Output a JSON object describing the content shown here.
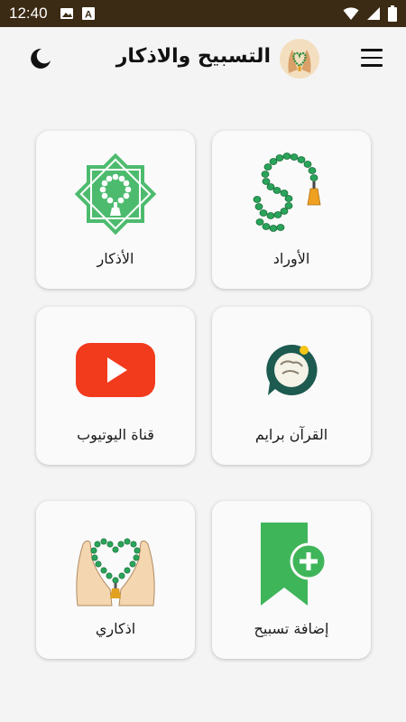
{
  "status_bar": {
    "time": "12:40",
    "left_icons": [
      "image-icon",
      "keyboard-a-icon"
    ],
    "right_icons": [
      "wifi-icon",
      "signal-icon",
      "battery-icon"
    ]
  },
  "app_bar": {
    "title": "التسبيح والاذكار",
    "menu_icon": "menu-icon",
    "theme_icon": "moon-icon",
    "logo_icon": "hands-heart-logo"
  },
  "grid": {
    "items": [
      {
        "label": "الأذكار",
        "icon": "tasbih-star-icon"
      },
      {
        "label": "الأوراد",
        "icon": "prayer-beads-icon"
      },
      {
        "label": "قناة اليوتيوب",
        "icon": "youtube-icon"
      },
      {
        "label": "القرآن برايم",
        "icon": "quran-chat-icon"
      },
      {
        "label": "اذكاري",
        "icon": "praying-hands-beads-icon"
      },
      {
        "label": "إضافة تسبيح",
        "icon": "bookmark-add-icon"
      }
    ]
  },
  "colors": {
    "status_bar": "#3b2a14",
    "background": "#f4f4f4",
    "card": "#fafafa",
    "green": "#3fb55a",
    "youtube_red": "#f23a1d"
  }
}
